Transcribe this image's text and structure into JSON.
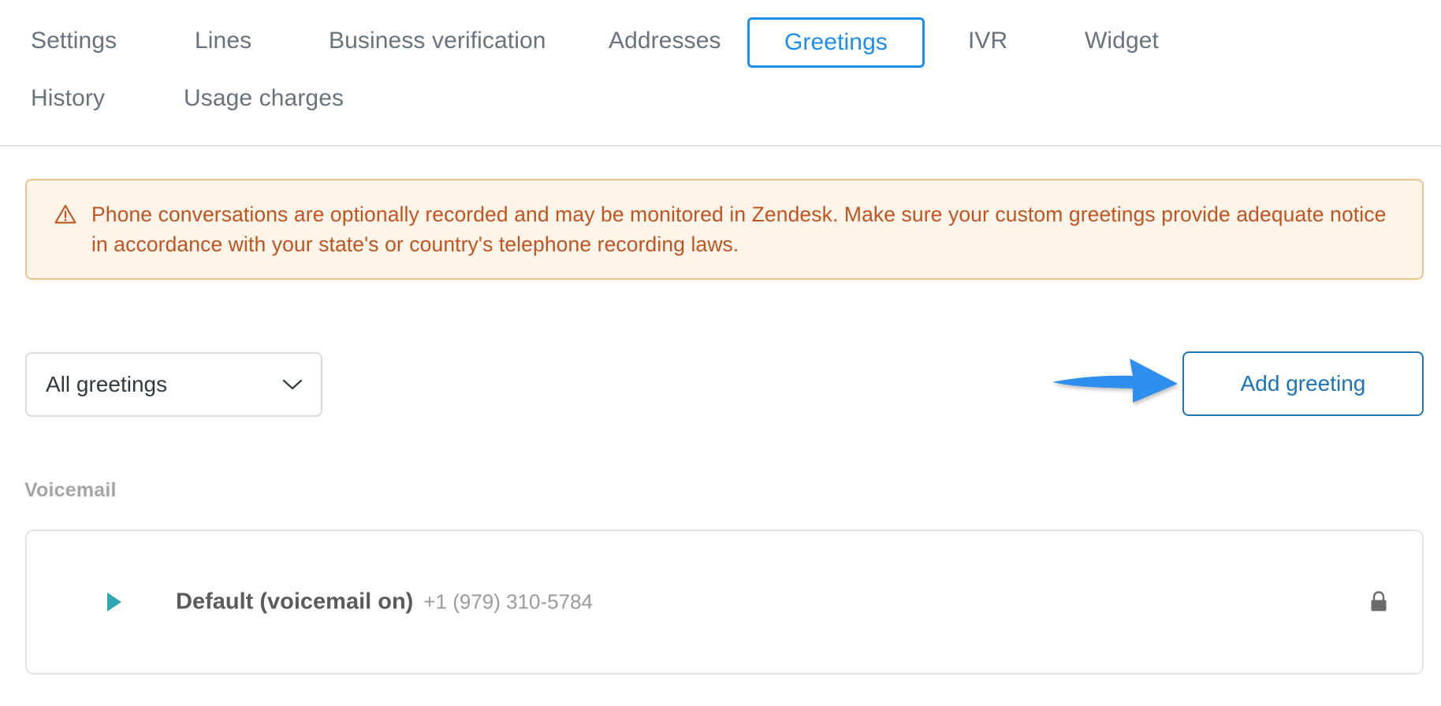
{
  "tabs": [
    {
      "label": "Settings",
      "name": "tab-settings",
      "active": false
    },
    {
      "label": "Lines",
      "name": "tab-lines",
      "active": false
    },
    {
      "label": "Business verification",
      "name": "tab-business-verification",
      "active": false
    },
    {
      "label": "Addresses",
      "name": "tab-addresses",
      "active": false
    },
    {
      "label": "Greetings",
      "name": "tab-greetings",
      "active": true
    },
    {
      "label": "IVR",
      "name": "tab-ivr",
      "active": false
    },
    {
      "label": "Widget",
      "name": "tab-widget",
      "active": false
    },
    {
      "label": "History",
      "name": "tab-history",
      "active": false
    },
    {
      "label": "Usage charges",
      "name": "tab-usage-charges",
      "active": false
    }
  ],
  "banner": {
    "icon": "warning-triangle-icon",
    "text": "Phone conversations are optionally recorded and may be monitored in Zendesk. Make sure your custom greetings provide adequate notice in accordance with your state's or country's telephone recording laws.",
    "background_color": "#fdf4ea",
    "border_color": "#efc48f",
    "text_color": "#c1541f"
  },
  "controls": {
    "filter_select": {
      "value": "All greetings",
      "icon": "chevron-down-icon"
    },
    "add_button": {
      "label": "Add greeting",
      "color": "#1f73b7"
    },
    "annotation_arrow": {
      "icon": "arrow-right-annotation",
      "color": "#2e8fef"
    }
  },
  "sections": [
    {
      "title": "Voicemail",
      "rows": [
        {
          "play_icon": "play-triangle-icon",
          "name": "Default (voicemail on)",
          "phone": "+1 (979) 310-5784",
          "lock_icon": "lock-icon"
        }
      ]
    }
  ],
  "colors": {
    "accent_blue": "#1f8ded",
    "link_blue": "#1f73b7",
    "tab_gray": "#68737d",
    "teal": "#31a5b5"
  }
}
